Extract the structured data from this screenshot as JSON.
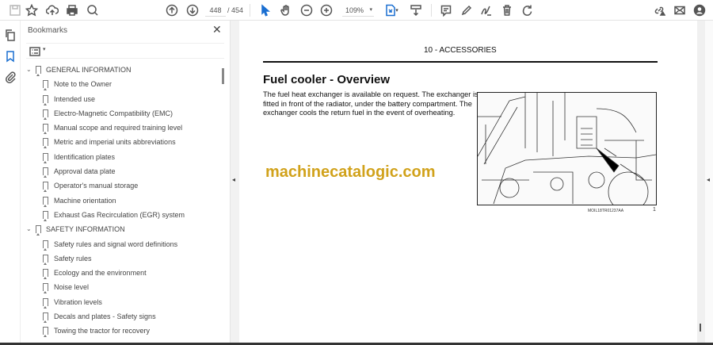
{
  "toolbar": {
    "page_current": "448",
    "page_total": "/ 454",
    "zoom": "109%"
  },
  "icons": [
    "save-icon",
    "star-icon",
    "cloud-upload-icon",
    "print-icon",
    "search-icon",
    "arrow-up-icon",
    "arrow-down-icon",
    "cursor-icon",
    "hand-icon",
    "zoom-out-icon",
    "zoom-in-icon",
    "page-fit-icon",
    "scroll-icon",
    "comment-icon",
    "pen-icon",
    "sign-icon",
    "delete-icon",
    "rotate-icon",
    "share-link-icon",
    "mail-icon",
    "account-icon"
  ],
  "bookmarks": {
    "title": "Bookmarks",
    "items": [
      {
        "label": "GENERAL INFORMATION",
        "level": 0
      },
      {
        "label": "Note to the Owner",
        "level": 1
      },
      {
        "label": "Intended use",
        "level": 1
      },
      {
        "label": "Electro-Magnetic Compatibility (EMC)",
        "level": 1
      },
      {
        "label": "Manual scope and required training level",
        "level": 1
      },
      {
        "label": "Metric and imperial units abbreviations",
        "level": 1
      },
      {
        "label": "Identification plates",
        "level": 1
      },
      {
        "label": "Approval data plate",
        "level": 1
      },
      {
        "label": "Operator's manual storage",
        "level": 1
      },
      {
        "label": "Machine orientation",
        "level": 1
      },
      {
        "label": "Exhaust Gas Recirculation (EGR) system",
        "level": 1
      },
      {
        "label": "SAFETY INFORMATION",
        "level": 0
      },
      {
        "label": "Safety rules and signal word definitions",
        "level": 1
      },
      {
        "label": "Safety rules",
        "level": 1
      },
      {
        "label": "Ecology and the environment",
        "level": 1
      },
      {
        "label": "Noise level",
        "level": 1
      },
      {
        "label": "Vibration levels",
        "level": 1
      },
      {
        "label": "Decals and plates - Safety signs",
        "level": 1
      },
      {
        "label": "Towing the tractor for recovery",
        "level": 1
      }
    ]
  },
  "document": {
    "section_header": "10 - ACCESSORIES",
    "heading": "Fuel cooler - Overview",
    "body": "The fuel heat exchanger is available on request. The exchanger is fitted in front of the radiator, under the battery compartment. The exchanger cools the return fuel in the event of overheating.",
    "watermark": "machinecatalogic.com",
    "figure_caption": "MOIL18TR01237AA",
    "figure_number": "1"
  }
}
